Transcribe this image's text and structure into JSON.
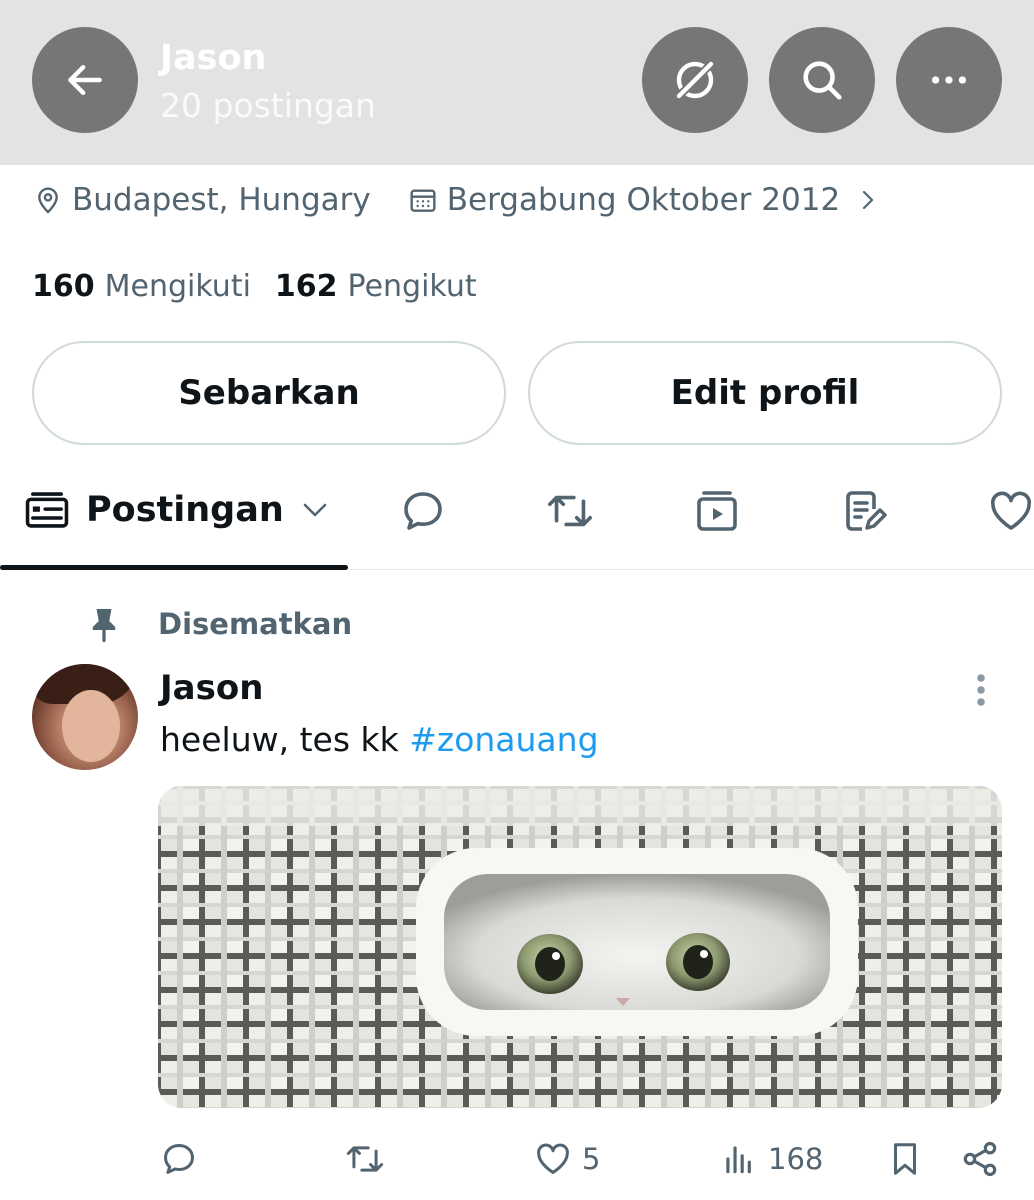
{
  "header": {
    "name": "Jason",
    "post_count": "20 postingan",
    "background_color": "#e3e3e3",
    "button_color": "#767676"
  },
  "meta": {
    "location": "Budapest, Hungary",
    "joined": "Bergabung Oktober 2012"
  },
  "stats": {
    "following_count": "160",
    "following_label": "Mengikuti",
    "followers_count": "162",
    "followers_label": "Pengikut"
  },
  "buttons": {
    "share_label": "Sebarkan",
    "edit_label": "Edit profil"
  },
  "tabs": {
    "posts_label": "Postingan",
    "icons": [
      "reply-icon",
      "repost-icon",
      "media-icon",
      "articles-icon",
      "like-icon"
    ]
  },
  "post": {
    "pinned_label": "Disematkan",
    "author": "Jason",
    "text": "heeluw, tes kk ",
    "hashtag": "#zonauang",
    "hashtag_color": "#1d9bf0",
    "likes": "5",
    "views": "168"
  }
}
